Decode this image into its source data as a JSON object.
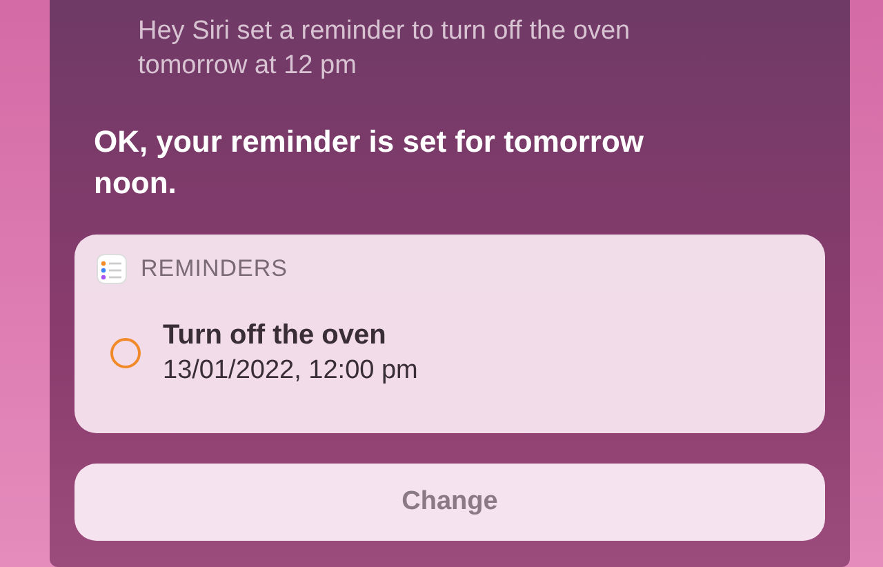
{
  "query": "Hey Siri set a reminder to turn off the oven tomorrow at 12 pm",
  "response": "OK, your reminder is set for tomorrow noon.",
  "card": {
    "app": "REMINDERS",
    "items": [
      {
        "title": "Turn off the oven",
        "due": "13/01/2022, 12:00 pm",
        "completed": false
      }
    ]
  },
  "button": "Change"
}
